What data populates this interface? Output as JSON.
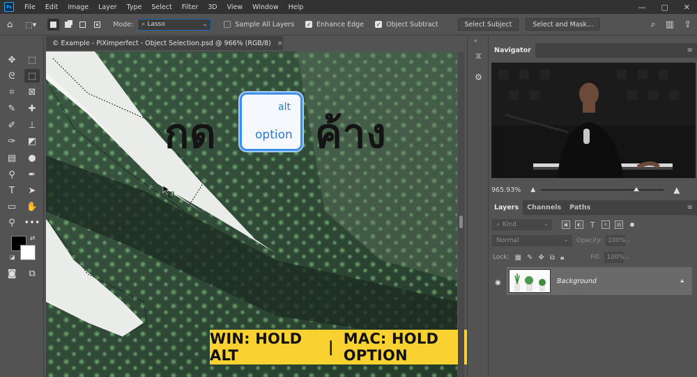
{
  "app": {
    "logo": "Ps"
  },
  "menu": [
    "File",
    "Edit",
    "Image",
    "Layer",
    "Type",
    "Select",
    "Filter",
    "3D",
    "View",
    "Window",
    "Help"
  ],
  "window_controls": [
    "—",
    "▢",
    "✕"
  ],
  "options_bar": {
    "mode_label": "Mode:",
    "mode_value": "Lasso",
    "sample_all_layers": {
      "label": "Sample All Layers",
      "checked": false
    },
    "enhance_edge": {
      "label": "Enhance Edge",
      "checked": true
    },
    "object_subtract": {
      "label": "Object Subtract",
      "checked": true
    },
    "select_subject": "Select Subject",
    "select_and_mask": "Select and Mask..."
  },
  "document": {
    "tab_title": "© Example - PiXimperfect - Object Selection.psd @ 966% (RGB/8)",
    "close": "×"
  },
  "overlay": {
    "thai_left": "กด",
    "thai_right": "ค้าง",
    "key_top": "alt",
    "key_bottom": "option",
    "banner_left": "WIN: HOLD ALT",
    "banner_sep": "|",
    "banner_right": "MAC: HOLD OPTION"
  },
  "navigator": {
    "title": "Navigator",
    "zoom": "965.93%",
    "zoom_fraction": 0.78
  },
  "layers_panel": {
    "tabs": [
      "Layers",
      "Channels",
      "Paths"
    ],
    "kind_placeholder": "Kind",
    "blend_mode": "Normal",
    "opacity_label": "Opacity:",
    "opacity_value": "100%",
    "lock_label": "Lock:",
    "fill_label": "Fill:",
    "fill_value": "100%",
    "layers": [
      {
        "name": "Background",
        "locked": true,
        "visible": true
      }
    ]
  },
  "colors": {
    "accent": "#3d8fe8",
    "banner": "#f9d232",
    "canvas_green": "#2f4a37"
  }
}
